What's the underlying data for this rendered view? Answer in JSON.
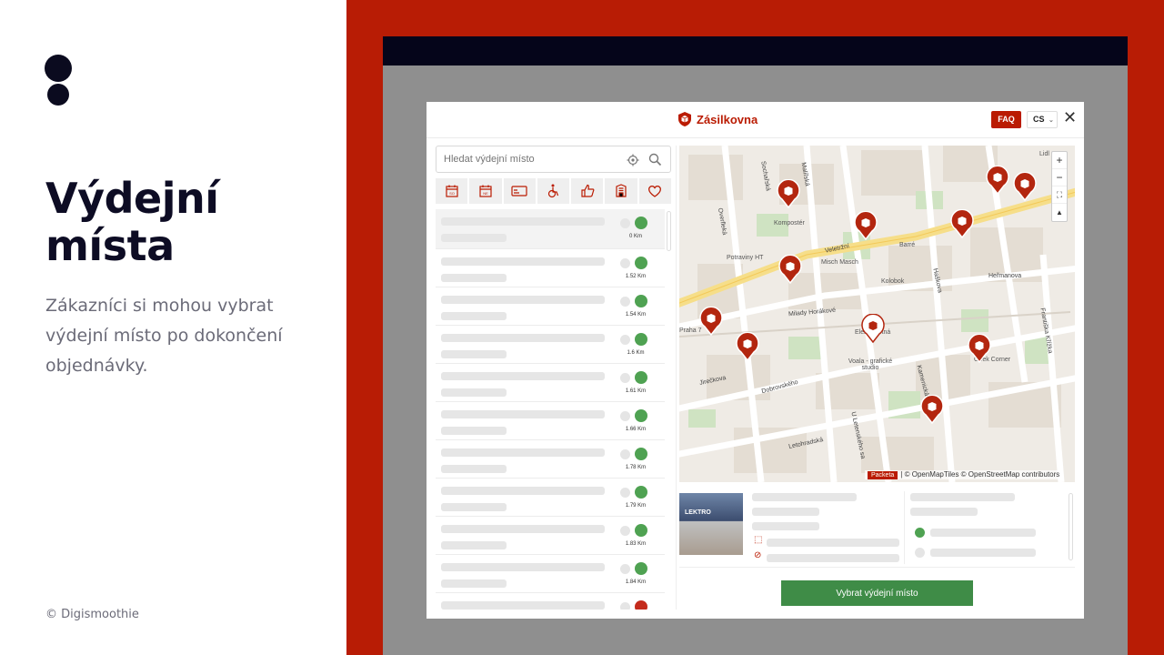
{
  "slide": {
    "heading_line1": "Výdejní",
    "heading_line2": "místa",
    "description": "Zákazníci si mohou vybrat výdejní místo po dokončení objednávky.",
    "copyright": "© Digismoothie"
  },
  "colors": {
    "brand_red": "#ba1b02",
    "frame_red": "#b81c05",
    "dark": "#0d0c24",
    "green": "#3f8c47"
  },
  "widget": {
    "brand": "Zásilkovna",
    "faq_label": "FAQ",
    "language": "CS",
    "search_placeholder": "Hledat výdejní místo",
    "filters": [
      {
        "icon": "calendar-sun-icon",
        "label": "SO"
      },
      {
        "icon": "calendar-sun-icon",
        "label": "NE"
      },
      {
        "icon": "card-icon",
        "label": ""
      },
      {
        "icon": "wheelchair-icon",
        "label": ""
      },
      {
        "icon": "thumbs-up-icon",
        "label": ""
      },
      {
        "icon": "building-icon",
        "label": ""
      },
      {
        "icon": "heart-icon",
        "label": ""
      }
    ],
    "distances": [
      "0 Km",
      "1.52 Km",
      "1.54 Km",
      "1.6 Km",
      "1.61 Km",
      "1.66 Km",
      "1.78 Km",
      "1.79 Km",
      "1.83 Km",
      "1.84 Km",
      ""
    ],
    "map": {
      "zoom_in": "+",
      "zoom_out": "−",
      "attribution": "| © OpenMapTiles © OpenStreetMap contributors",
      "packeta_label": "Packeta",
      "labels": [
        "Kompostér",
        "Potraviny HT",
        "Misch Masch",
        "Kolobok",
        "Barré",
        "Praha 7",
        "Elektrodetná",
        "Voala - grafické studio",
        "Geek Corner",
        "Lidl"
      ],
      "streets": [
        "Sochařská",
        "Malířská",
        "Veletržní",
        "Milady Horákové",
        "Jirečkova",
        "Dobrovského",
        "Letohradská",
        "Heřmanova",
        "Kamenická",
        "Františka Křížka",
        "Overfleká",
        "U Letenského sa",
        "Haškova"
      ]
    },
    "select_button": "Vybrat výdejní místo",
    "photo_label": "LEKTRO"
  }
}
